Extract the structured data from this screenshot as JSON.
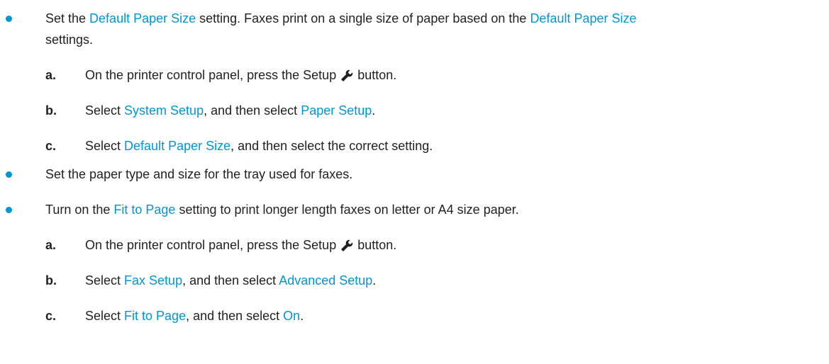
{
  "items": [
    {
      "line1": {
        "t1": "Set the ",
        "ui1": "Default Paper Size",
        "t2": " setting. Faxes print on a single size of paper based on the ",
        "ui2": "Default Paper Size"
      },
      "line2": "settings.",
      "steps": [
        {
          "letter": "a.",
          "t1": "On the printer control panel, press the Setup",
          "icon": "wrench-icon",
          "t2": "button."
        },
        {
          "letter": "b.",
          "t1": "Select ",
          "ui1": "System Setup",
          "t2": ", and then select ",
          "ui2": "Paper Setup",
          "t3": "."
        },
        {
          "letter": "c.",
          "t1": "Select ",
          "ui1": "Default Paper Size",
          "t2": ", and then select the correct setting."
        }
      ]
    },
    {
      "text": "Set the paper type and size for the tray used for faxes."
    },
    {
      "line1": {
        "t1": "Turn on the ",
        "ui1": "Fit to Page",
        "t2": " setting to print longer length faxes on letter or A4 size paper."
      },
      "steps": [
        {
          "letter": "a.",
          "t1": "On the printer control panel, press the Setup",
          "icon": "wrench-icon",
          "t2": "button."
        },
        {
          "letter": "b.",
          "t1": "Select ",
          "ui1": "Fax Setup",
          "t2": ", and then select ",
          "ui2": "Advanced Setup",
          "t3": "."
        },
        {
          "letter": "c.",
          "t1": "Select ",
          "ui1": "Fit to Page",
          "t2": ", and then select ",
          "ui2": "On",
          "t3": "."
        }
      ]
    }
  ],
  "colors": {
    "accent": "#0096d6",
    "text": "#231f20"
  }
}
